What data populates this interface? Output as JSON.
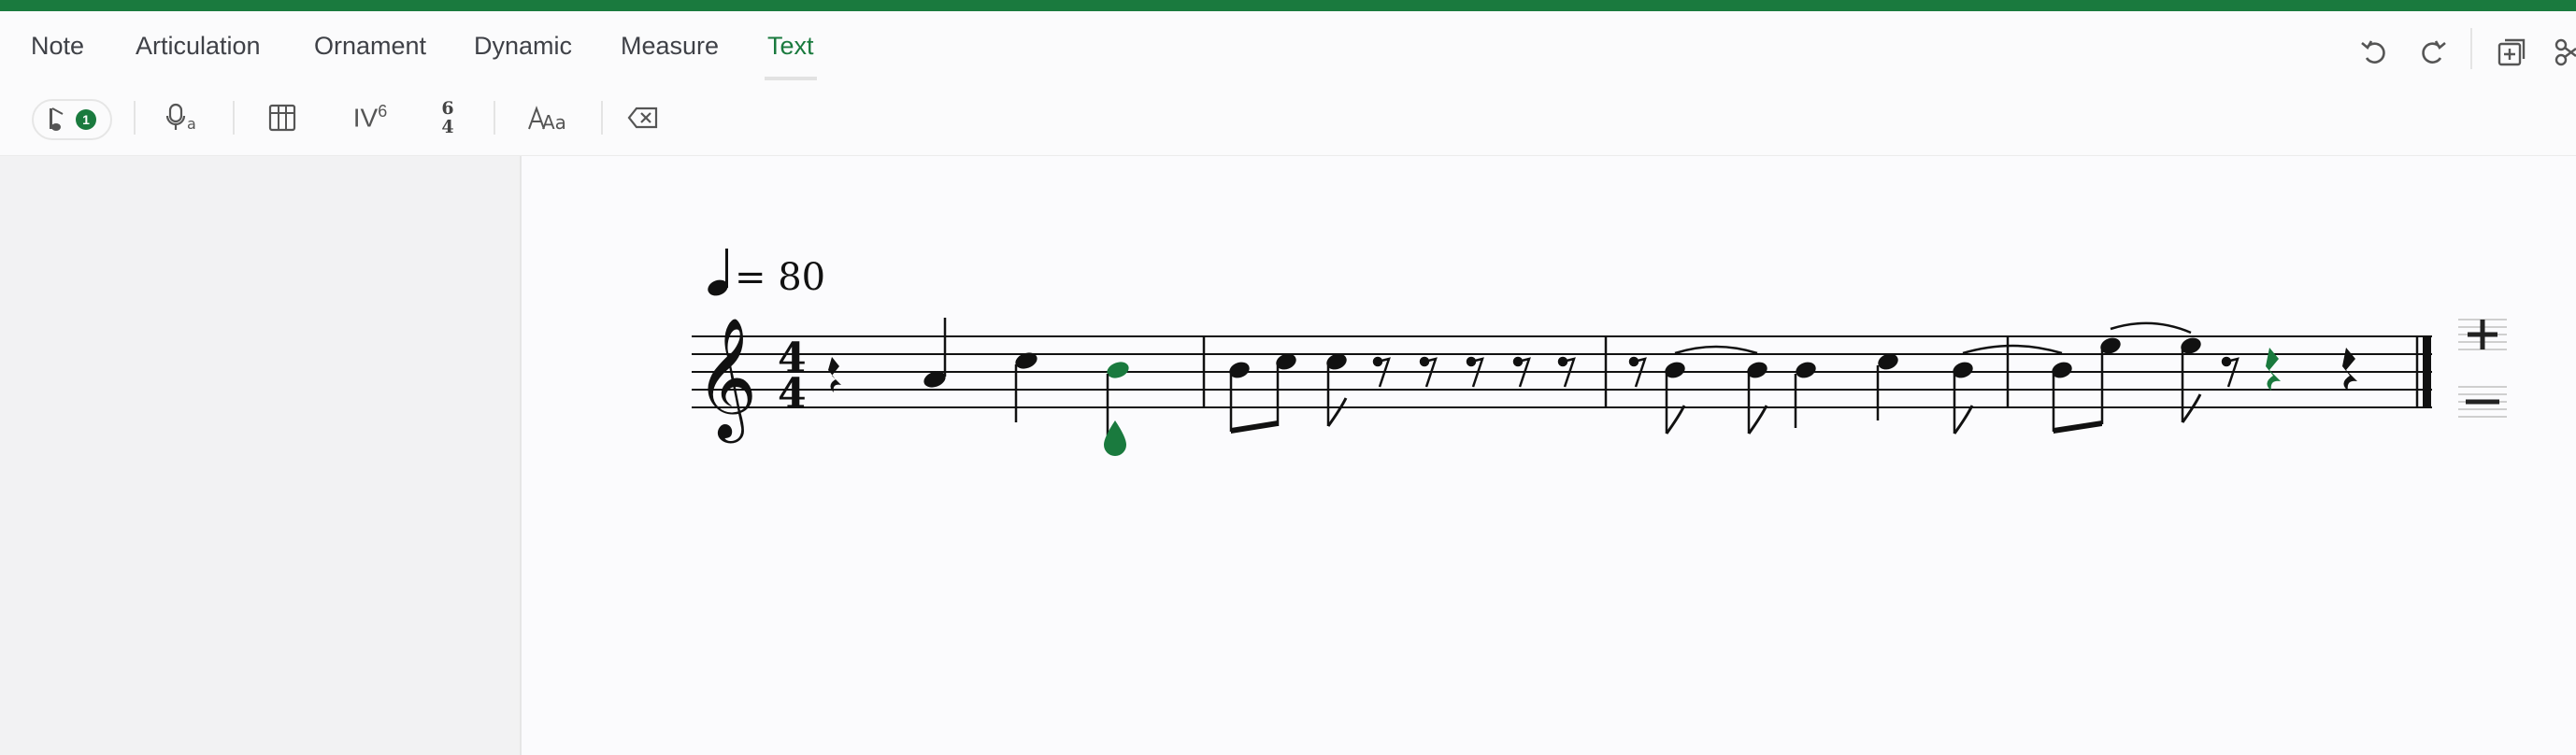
{
  "menu": {
    "tabs": [
      {
        "label": "Note"
      },
      {
        "label": "Articulation"
      },
      {
        "label": "Ornament"
      },
      {
        "label": "Dynamic"
      },
      {
        "label": "Measure"
      },
      {
        "label": "Text"
      }
    ],
    "active_tab": "Text"
  },
  "toolbar": {
    "voice_badge": "1",
    "roman_numeral": "IV",
    "roman_superscript": "6",
    "figured_bass_top": "6",
    "figured_bass_bottom": "4",
    "icons": [
      "voice-note-icon",
      "lyrics-mic-icon",
      "chord-grid-icon",
      "roman-numeral-icon",
      "figured-bass-icon",
      "text-style-icon",
      "delete-icon"
    ]
  },
  "score": {
    "tempo": "= 80",
    "time_signature": {
      "top": "4",
      "bottom": "4"
    },
    "clef": "treble",
    "accent_color": "#1a7a3e",
    "measures": 4,
    "zoom_in_icon": "plus-icon",
    "zoom_out_icon": "minus-icon"
  },
  "colors": {
    "brand": "#1a7a3e",
    "text": "#3f4147",
    "sidebar": "#f2f2f3"
  }
}
